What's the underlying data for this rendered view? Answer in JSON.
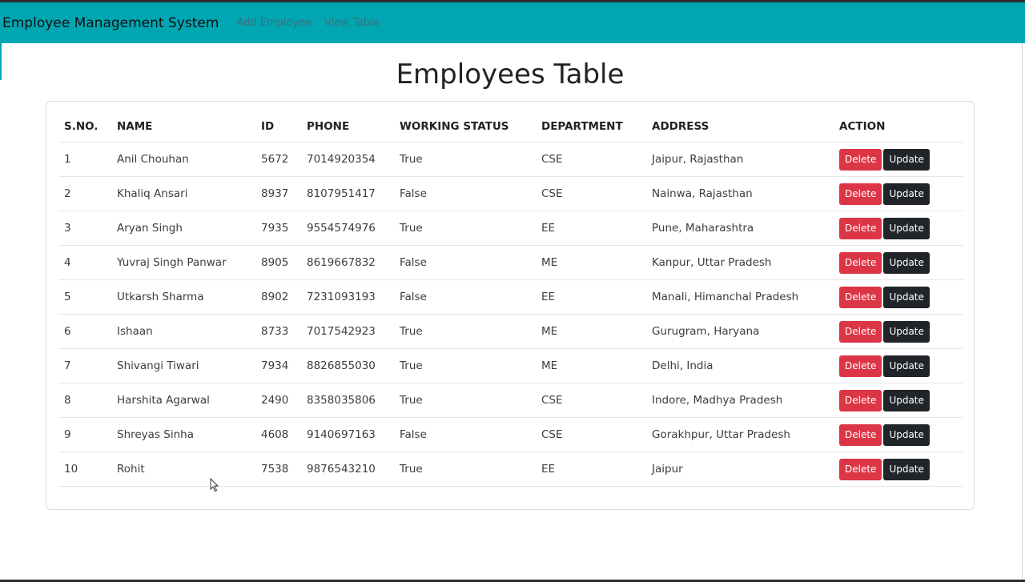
{
  "navbar": {
    "brand": "Employee Management System",
    "links": [
      "Add Employee",
      "View Table"
    ]
  },
  "page": {
    "title": "Employees Table"
  },
  "table": {
    "columns": [
      "S.NO.",
      "NAME",
      "ID",
      "PHONE",
      "WORKING STATUS",
      "DEPARTMENT",
      "ADDRESS",
      "ACTION"
    ],
    "rows": [
      [
        "1",
        "Anil Chouhan",
        "5672",
        "7014920354",
        "True",
        "CSE",
        "Jaipur, Rajasthan"
      ],
      [
        "2",
        "Khaliq Ansari",
        "8937",
        "8107951417",
        "False",
        "CSE",
        "Nainwa, Rajasthan"
      ],
      [
        "3",
        "Aryan Singh",
        "7935",
        "9554574976",
        "True",
        "EE",
        "Pune, Maharashtra"
      ],
      [
        "4",
        "Yuvraj Singh Panwar",
        "8905",
        "8619667832",
        "False",
        "ME",
        "Kanpur, Uttar Pradesh"
      ],
      [
        "5",
        "Utkarsh Sharma",
        "8902",
        "7231093193",
        "False",
        "EE",
        "Manali, Himanchal Pradesh"
      ],
      [
        "6",
        "Ishaan",
        "8733",
        "7017542923",
        "True",
        "ME",
        "Gurugram, Haryana"
      ],
      [
        "7",
        "Shivangi Tiwari",
        "7934",
        "8826855030",
        "True",
        "ME",
        "Delhi, India"
      ],
      [
        "8",
        "Harshita Agarwal",
        "2490",
        "8358035806",
        "True",
        "CSE",
        "Indore, Madhya Pradesh"
      ],
      [
        "9",
        "Shreyas Sinha",
        "4608",
        "9140697163",
        "False",
        "CSE",
        "Gorakhpur, Uttar Pradesh"
      ],
      [
        "10",
        "Rohit",
        "7538",
        "9876543210",
        "True",
        "EE",
        "Jaipur"
      ]
    ],
    "actions": {
      "delete_label": "Delete",
      "update_label": "Update"
    }
  },
  "colors": {
    "navbar": "#00a6b2",
    "delete": "#dc3545",
    "update": "#212529"
  },
  "icons": {
    "cursor": "mouse-pointer-icon"
  }
}
